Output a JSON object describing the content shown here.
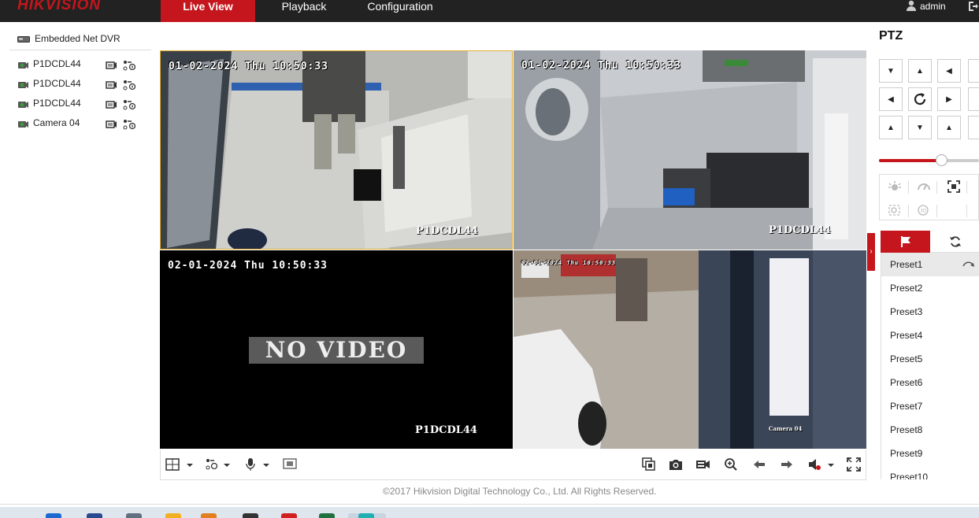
{
  "header": {
    "logo": "HIKVISION",
    "tabs": [
      {
        "label": "Live View",
        "active": true
      },
      {
        "label": "Playback",
        "active": false
      },
      {
        "label": "Configuration",
        "active": false
      }
    ],
    "user": "admin"
  },
  "sidebar": {
    "device": "Embedded Net DVR",
    "cameras": [
      {
        "label": "P1DCDL44"
      },
      {
        "label": "P1DCDL44"
      },
      {
        "label": "P1DCDL44"
      },
      {
        "label": "Camera 04"
      }
    ]
  },
  "video": {
    "tiles": [
      {
        "timestamp": "01-02-2024 Thu 10:50:33",
        "camera": "P1DCDL44",
        "selected": true
      },
      {
        "timestamp": "01-02-2024 Thu 10:50:33",
        "camera": "P1DCDL44",
        "selected": false
      },
      {
        "timestamp": "02-01-2024 Thu 10:50:33",
        "camera": "P1DCDL44",
        "no_video": "NO VIDEO",
        "selected": false
      },
      {
        "timestamp": "02-01-2024 Thu 10:50:33",
        "camera": "Camera 04",
        "selected": false
      }
    ]
  },
  "toolbar": {
    "left_icons": [
      "window-layout-icon",
      "stream-icon",
      "microphone-icon",
      "zoom-region-icon"
    ],
    "right_icons": [
      "stop-all-icon",
      "capture-icon",
      "record-icon",
      "digital-zoom-icon",
      "previous-page-icon",
      "next-page-icon",
      "volume-mute-icon",
      "fullscreen-icon"
    ]
  },
  "footer": {
    "copyright": "©2017 Hikvision Digital Technology Co., Ltd. All Rights Reserved."
  },
  "ptz": {
    "title": "PTZ",
    "speed_level": 0.62,
    "presets": [
      "Preset1",
      "Preset2",
      "Preset3",
      "Preset4",
      "Preset5",
      "Preset6",
      "Preset7",
      "Preset8",
      "Preset9",
      "Preset10"
    ],
    "selected_preset": "Preset1"
  },
  "colors": {
    "brand_red": "#c4161c",
    "topbar": "#222222"
  }
}
